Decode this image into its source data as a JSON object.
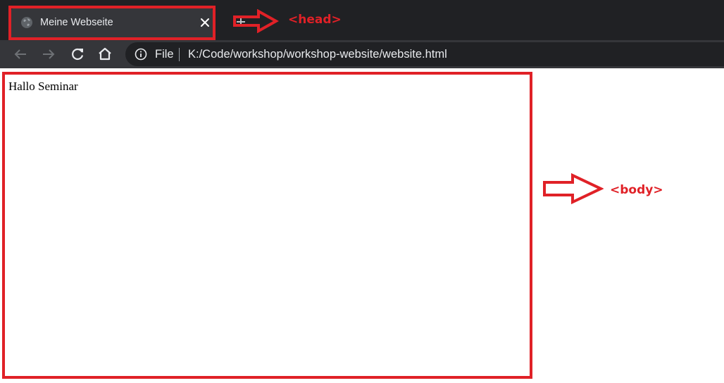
{
  "browser": {
    "tab": {
      "title": "Meine Webseite",
      "favicon_icon": "globe-icon",
      "close_icon": "close-icon"
    },
    "new_tab_icon": "plus-icon",
    "nav": {
      "back_icon": "arrow-left-icon",
      "forward_icon": "arrow-right-icon",
      "reload_icon": "reload-icon",
      "home_icon": "home-icon"
    },
    "address_bar": {
      "info_icon": "info-icon",
      "scheme_label": "File",
      "url": "K:/Code/workshop/workshop-website/website.html"
    }
  },
  "page": {
    "text": "Hallo Seminar"
  },
  "annotations": {
    "accent_color": "#e02127",
    "head_label": "<head>",
    "body_label": "<body>"
  },
  "colors": {
    "tab_strip": "#202124",
    "toolbar": "#35363a",
    "omnibox": "#202124",
    "text_light": "#e8eaed"
  }
}
